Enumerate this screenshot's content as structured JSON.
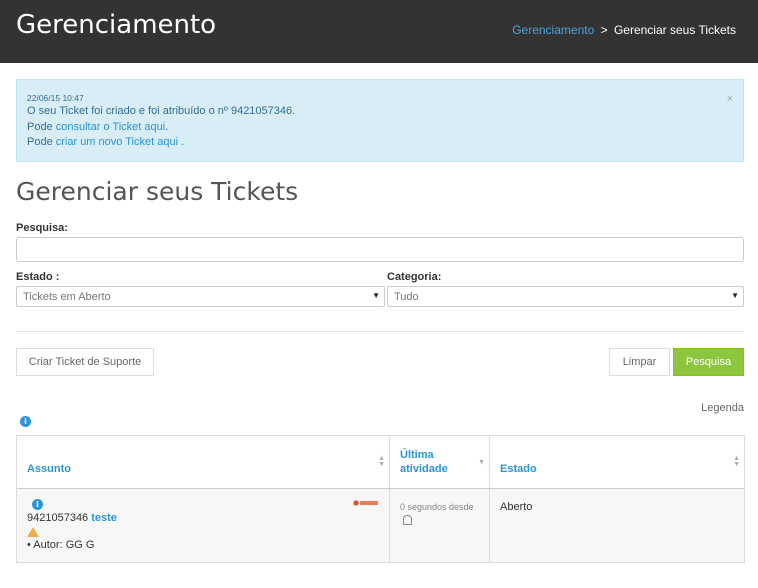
{
  "header": {
    "title": "Gerenciamento",
    "breadcrumb": {
      "link": "Gerenciamento",
      "separator": ">",
      "current": "Gerenciar seus Tickets"
    }
  },
  "alert": {
    "timestamp": "22/06/15 10:47",
    "line1": "O seu Ticket foi criado e foi atribuído o nº 9421057346.",
    "line2_prefix": "Pode ",
    "line2_link": "consultar o Ticket aqui",
    "line2_suffix": ".",
    "line3_prefix": "Pode ",
    "line3_link": "criar um novo Ticket aqui",
    "line3_suffix": " .",
    "close": "×"
  },
  "page": {
    "title": "Gerenciar seus Tickets"
  },
  "form": {
    "search_label": "Pesquisa:",
    "search_value": "",
    "estado_label": "Estado :",
    "estado_value": "Tickets em Aberto",
    "categoria_label": "Categoria:",
    "categoria_value": "Tudo"
  },
  "actions": {
    "create_ticket": "Criar Ticket de Suporte",
    "clear": "Limpar",
    "search": "Pesquisa"
  },
  "legend": {
    "label": "Legenda"
  },
  "table": {
    "headers": {
      "assunto": "Assunto",
      "ultima_atividade_1": "Última",
      "ultima_atividade_2": "atividade",
      "estado": "Estado"
    },
    "rows": [
      {
        "ticket_number": "9421057346",
        "subject": "teste",
        "author": "• Autor: GG G",
        "activity": "0 segundos desde",
        "status": "Aberto"
      }
    ]
  },
  "colors": {
    "topbar": "#333333",
    "link": "#2a95d4",
    "primary_button": "#8cc63f",
    "alert_bg": "#d9edf7"
  },
  "icons": {
    "info": "info-circle-icon",
    "warning": "warning-triangle-icon",
    "user": "user-icon",
    "brand": "brand-logo-icon",
    "sort": "sort-icon",
    "dropdown": "caret-down-icon"
  }
}
